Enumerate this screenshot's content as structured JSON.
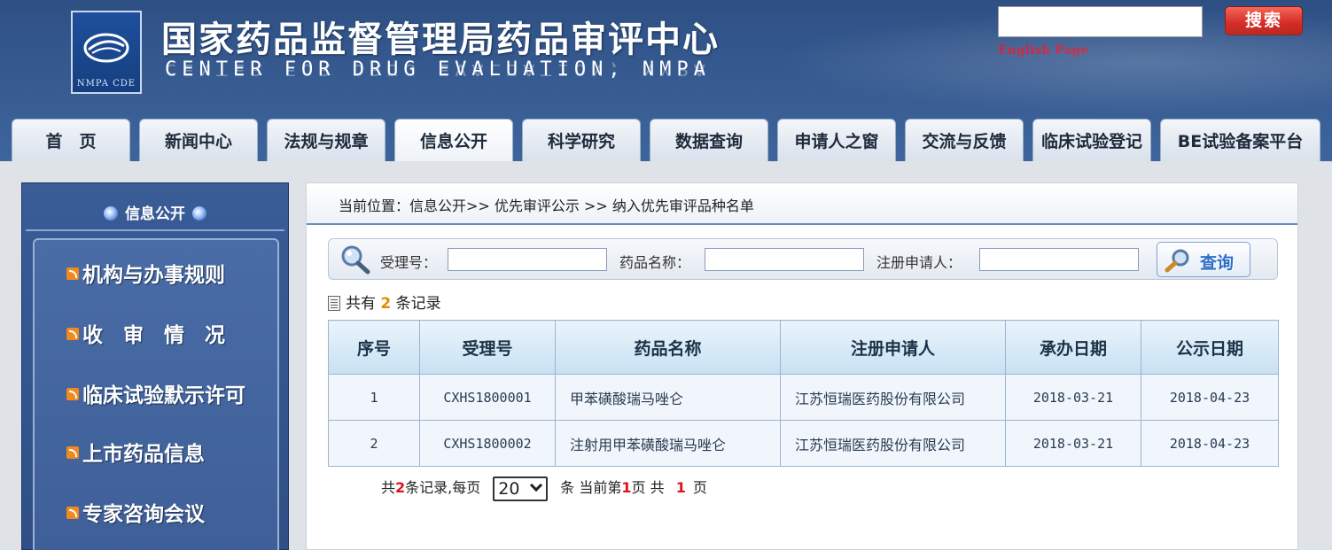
{
  "header": {
    "title_cn": "国家药品监督管理局药品审评中心",
    "title_en": "CENTER FOR DRUG EVALUATION, NMPA",
    "logo_text": "NMPA CDE",
    "search_button": "搜索",
    "english_link": "English Page"
  },
  "nav": {
    "tabs": [
      {
        "label": "首　页"
      },
      {
        "label": "新闻中心"
      },
      {
        "label": "法规与规章"
      },
      {
        "label": "信息公开"
      },
      {
        "label": "科学研究"
      },
      {
        "label": "数据查询"
      },
      {
        "label": "申请人之窗"
      },
      {
        "label": "交流与反馈"
      },
      {
        "label": "临床试验登记"
      },
      {
        "label": "BE试验备案平台"
      }
    ]
  },
  "sidebar": {
    "title": "信息公开",
    "items": [
      {
        "label": "机构与办事规则"
      },
      {
        "label": "收　审　情　况"
      },
      {
        "label": "临床试验默示许可"
      },
      {
        "label": "上市药品信息"
      },
      {
        "label": "专家咨询会议"
      }
    ]
  },
  "main": {
    "breadcrumb": "当前位置：信息公开>> 优先审评公示 >> 纳入优先审评品种名单",
    "filters": {
      "acceptance_no_label": "受理号：",
      "acceptance_no_value": "",
      "drug_name_label": "药品名称：",
      "drug_name_value": "",
      "applicant_label": "注册申请人：",
      "applicant_value": "",
      "query_button": "查询"
    },
    "record_summary": {
      "prefix": "共有",
      "count": "2",
      "suffix": "条记录"
    },
    "table": {
      "headers": [
        "序号",
        "受理号",
        "药品名称",
        "注册申请人",
        "承办日期",
        "公示日期"
      ],
      "rows": [
        [
          "1",
          "CXHS1800001",
          "甲苯磺酸瑞马唑仑",
          "江苏恒瑞医药股份有限公司",
          "2018-03-21",
          "2018-04-23"
        ],
        [
          "2",
          "CXHS1800002",
          "注射用甲苯磺酸瑞马唑仑",
          "江苏恒瑞医药股份有限公司",
          "2018-03-21",
          "2018-04-23"
        ]
      ]
    },
    "pager": {
      "total_prefix": "共",
      "total": "2",
      "total_suffix": "条记录,每页",
      "page_size": "20",
      "unit": "条",
      "current_prefix": "当前第",
      "current": "1",
      "current_suffix": "页 共",
      "pages": "1",
      "pages_suffix": "页"
    }
  },
  "colors": {
    "header_bg": "#35598f",
    "search_red": "#d4241d",
    "english_red": "#c8102e",
    "sidebar_bg": "#3a5c97",
    "count_orange": "#e68a00",
    "pager_red": "#d8141a"
  }
}
